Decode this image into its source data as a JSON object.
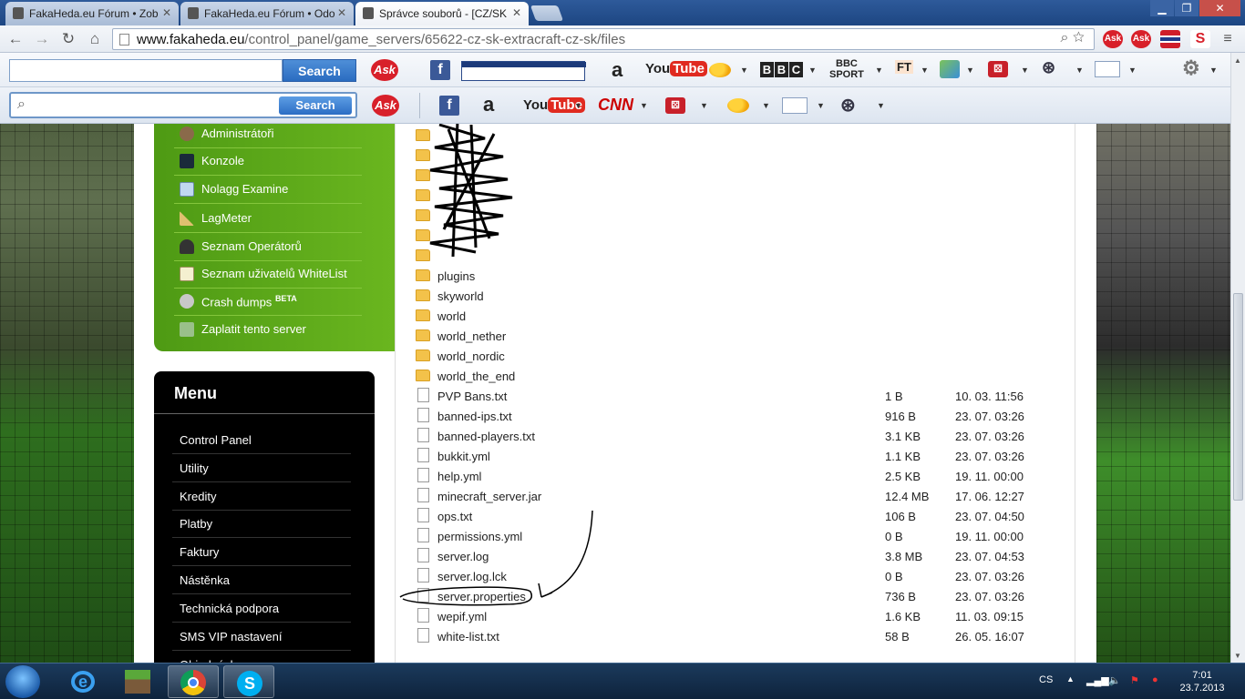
{
  "browser": {
    "tabs": [
      {
        "title": "FakaHeda.eu Fórum • Zob"
      },
      {
        "title": "FakaHeda.eu Fórum • Odo"
      },
      {
        "title": "Správce souborů - [CZ/SK"
      }
    ],
    "url_host": "www.fakaheda.eu",
    "url_path": "/control_panel/game_servers/65622-cz-sk-extracraft-cz-sk/files"
  },
  "toolbar1": {
    "search_label": "Search",
    "ask": "Ask",
    "youtube_you": "You",
    "youtube_tube": "Tube",
    "bbc": [
      "B",
      "B",
      "C"
    ],
    "bbc_sport_top": "BBC",
    "bbc_sport_bottom": "SPORT",
    "ft": "FT"
  },
  "toolbar2": {
    "search_label": "Search",
    "ask": "Ask",
    "cnn": "CNN",
    "youtube_you": "You",
    "youtube_tube": "Tube"
  },
  "sidebar": {
    "green_items": [
      {
        "label": "Administrátoři"
      },
      {
        "label": "Konzole"
      },
      {
        "label": "Nolagg Examine"
      },
      {
        "label": "LagMeter"
      },
      {
        "label": "Seznam Operátorů"
      },
      {
        "label": "Seznam uživatelů WhiteList"
      },
      {
        "label": "Crash dumps",
        "badge": "BETA"
      },
      {
        "label": "Zaplatit tento server"
      }
    ],
    "menu_title": "Menu",
    "menu_items": [
      {
        "label": "Control Panel"
      },
      {
        "label": "Utility"
      },
      {
        "label": "Kredity"
      },
      {
        "label": "Platby"
      },
      {
        "label": "Faktury"
      },
      {
        "label": "Nástěnka"
      },
      {
        "label": "Technická podpora"
      },
      {
        "label": "SMS VIP nastavení"
      },
      {
        "label": "Objednávky"
      }
    ]
  },
  "files": {
    "folders": [
      {
        "name": "plugins"
      },
      {
        "name": "skyworld"
      },
      {
        "name": "world"
      },
      {
        "name": "world_nether"
      },
      {
        "name": "world_nordic"
      },
      {
        "name": "world_the_end"
      }
    ],
    "items": [
      {
        "name": "PVP Bans.txt",
        "size": "1 B",
        "date": "10. 03. 11:56"
      },
      {
        "name": "banned-ips.txt",
        "size": "916 B",
        "date": "23. 07. 03:26"
      },
      {
        "name": "banned-players.txt",
        "size": "3.1 KB",
        "date": "23. 07. 03:26"
      },
      {
        "name": "bukkit.yml",
        "size": "1.1 KB",
        "date": "23. 07. 03:26"
      },
      {
        "name": "help.yml",
        "size": "2.5 KB",
        "date": "19. 11. 00:00"
      },
      {
        "name": "minecraft_server.jar",
        "size": "12.4 MB",
        "date": "17. 06. 12:27"
      },
      {
        "name": "ops.txt",
        "size": "106 B",
        "date": "23. 07. 04:50"
      },
      {
        "name": "permissions.yml",
        "size": "0 B",
        "date": "19. 11. 00:00"
      },
      {
        "name": "server.log",
        "size": "3.8 MB",
        "date": "23. 07. 04:53"
      },
      {
        "name": "server.log.lck",
        "size": "0 B",
        "date": "23. 07. 03:26"
      },
      {
        "name": "server.properties",
        "size": "736 B",
        "date": "23. 07. 03:26"
      },
      {
        "name": "wepif.yml",
        "size": "1.6 KB",
        "date": "11. 03. 09:15"
      },
      {
        "name": "white-list.txt",
        "size": "58 B",
        "date": "26. 05. 16:07"
      }
    ]
  },
  "taskbar": {
    "lang": "CS",
    "time": "7:01",
    "date": "23.7.2013"
  },
  "colors": {
    "green": "#5aa81a",
    "menu_bg": "#000000",
    "folder": "#f3c24a",
    "taskbar": "#1b3a5c"
  }
}
